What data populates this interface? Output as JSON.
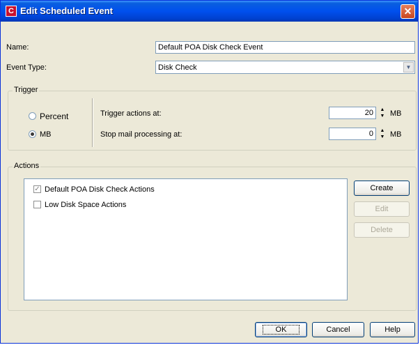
{
  "window": {
    "title": "Edit Scheduled Event",
    "app_icon_letter": "C",
    "close_glyph": "✕"
  },
  "form": {
    "name_label": "Name:",
    "name_value": "Default POA Disk Check Event",
    "event_type_label": "Event Type:",
    "event_type_value": "Disk Check"
  },
  "trigger": {
    "group_title": "Trigger",
    "percent_label": "Percent",
    "mb_label": "MB",
    "selected": "MB",
    "trigger_actions_label": "Trigger actions at:",
    "trigger_actions_value": "20",
    "trigger_actions_unit": "MB",
    "stop_mail_label": "Stop mail processing at:",
    "stop_mail_value": "0",
    "stop_mail_unit": "MB"
  },
  "actions": {
    "group_title": "Actions",
    "items": [
      {
        "label": "Default POA Disk Check Actions",
        "checked": true
      },
      {
        "label": "Low Disk Space Actions",
        "checked": false
      }
    ],
    "create_label": "Create",
    "edit_label": "Edit",
    "delete_label": "Delete"
  },
  "buttons": {
    "ok": "OK",
    "cancel": "Cancel",
    "help": "Help"
  },
  "colors": {
    "titlebar": "#0050ee",
    "dialog_bg": "#ece9d8",
    "field_border": "#7f9db9"
  }
}
